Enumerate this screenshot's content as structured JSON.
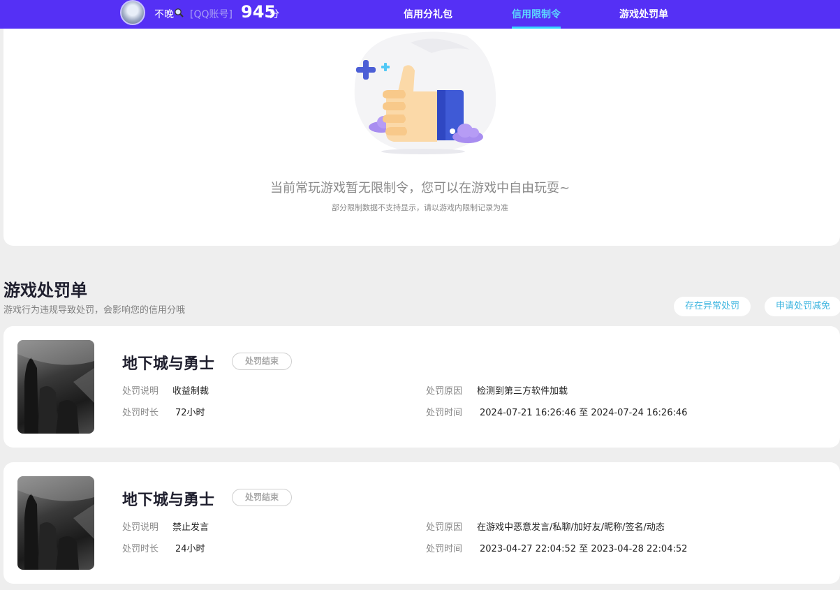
{
  "header": {
    "username": "不晚",
    "account_tag": "[QQ账号]",
    "score": "945",
    "score_unit": "分",
    "tabs": [
      {
        "label": "信用分礼包"
      },
      {
        "label": "信用限制令"
      },
      {
        "label": "游戏处罚单"
      }
    ],
    "active_tab": "信用限制令"
  },
  "restriction": {
    "empty_message": "当前常玩游戏暂无限制令，您可以在游戏中自由玩耍~",
    "empty_note": "部分限制数据不支持显示，请以游戏内限制记录为准"
  },
  "penalties": {
    "title": "游戏处罚单",
    "description": "游戏行为违规导致处罚，会影响您的信用分哦",
    "actions": {
      "abnormal": "存在异常处罚",
      "reduce": "申请处罚减免"
    },
    "labels": {
      "explain": "处罚说明",
      "duration": "处罚时长",
      "reason": "处罚原因",
      "time": "处罚时间"
    },
    "items": [
      {
        "game": "地下城与勇士",
        "status": "处罚结束",
        "explain": "收益制裁",
        "duration": "72小时",
        "reason": "检测到第三方软件加载",
        "time": "2024-07-21 16:26:46 至 2024-07-24 16:26:46"
      },
      {
        "game": "地下城与勇士",
        "status": "处罚结束",
        "explain": "禁止发言",
        "duration": "24小时",
        "reason": "在游戏中恶意发言/私聊/加好友/昵称/签名/动态",
        "time": "2023-04-27 22:04:52 至 2023-04-28 22:04:52"
      }
    ]
  },
  "colors": {
    "topbar": "#5530f5",
    "active_tab": "#5dd6ff",
    "pill_text": "#3fb6e0"
  }
}
